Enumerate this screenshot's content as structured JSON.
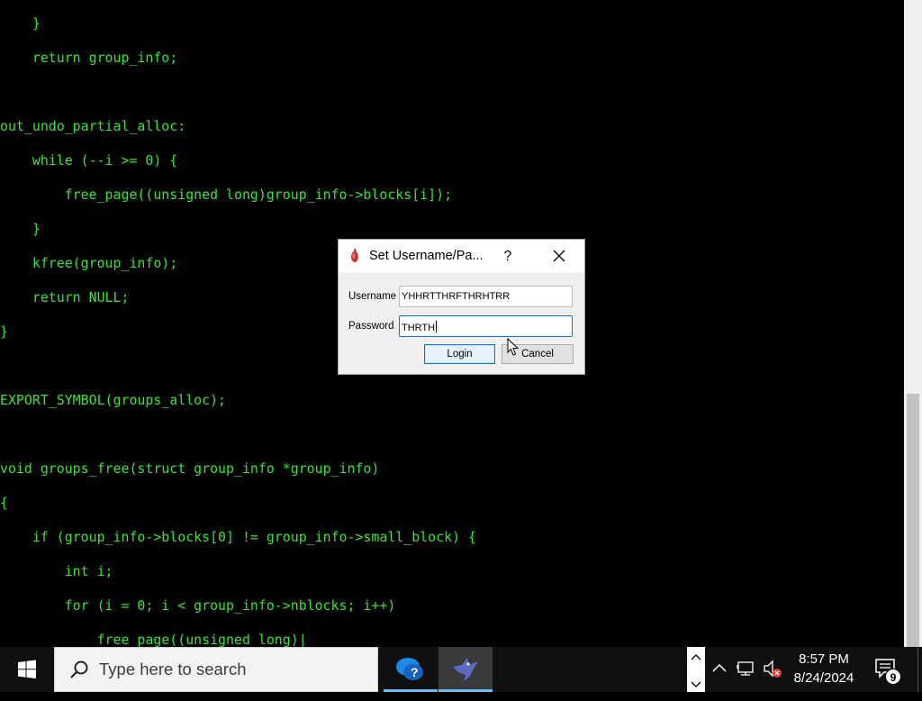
{
  "code_lines": [
    "    }",
    "    return group_info;",
    "",
    "out_undo_partial_alloc:",
    "    while (--i >= 0) {",
    "        free_page((unsigned long)group_info->blocks[i]);",
    "    }",
    "    kfree(group_info);",
    "    return NULL;",
    "}",
    "",
    "EXPORT_SYMBOL(groups_alloc);",
    "",
    "void groups_free(struct group_info *group_info)",
    "{",
    "    if (group_info->blocks[0] != group_info->small_block) {",
    "        int i;",
    "        for (i = 0; i < group_info->nblocks; i++)",
    "            free_page((unsigned long)|"
  ],
  "dialog": {
    "title": "Set Username/Pa...",
    "help_label": "?",
    "username_label": "Username",
    "username_value": "YHHRTTHRFTHRHTRR",
    "password_label": "Password",
    "password_value": "THRTH",
    "login_label": "Login",
    "cancel_label": "Cancel"
  },
  "taskbar": {
    "search_placeholder": "Type here to search",
    "time": "8:57 PM",
    "date": "8/24/2024",
    "notification_count": "9"
  },
  "colors": {
    "code_text": "#35e62e",
    "background": "#000000",
    "accent": "#0078d7"
  }
}
